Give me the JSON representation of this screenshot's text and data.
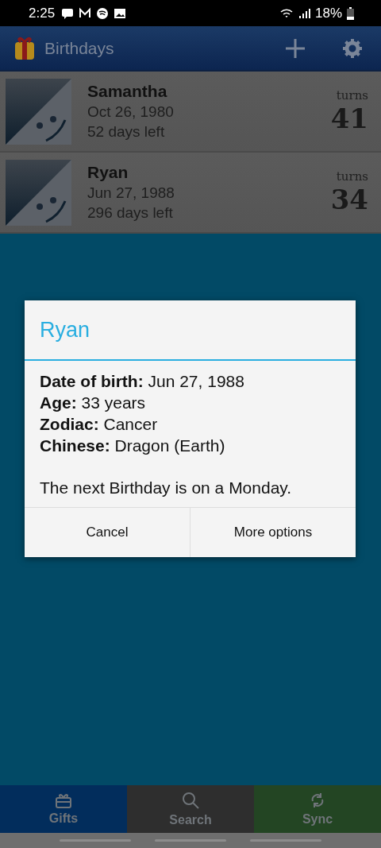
{
  "status_bar": {
    "time": "2:25",
    "battery": "18%"
  },
  "app_bar": {
    "title": "Birthdays"
  },
  "people": [
    {
      "name": "Samantha",
      "date": "Oct 26, 1980",
      "days_left": "52 days left",
      "turns_label": "turns",
      "turns": "41"
    },
    {
      "name": "Ryan",
      "date": "Jun 27, 1988",
      "days_left": "296 days left",
      "turns_label": "turns",
      "turns": "34"
    }
  ],
  "dialog": {
    "title": "Ryan",
    "lines": [
      "**Date of birth:** Jun 27, 1988",
      "**Age:** 33 years",
      "**Zodiac:** Cancer",
      "**Chinese:** Dragon (Earth)"
    ],
    "note": "The next Birthday is on a Monday.",
    "buttons": [
      "Cancel",
      "More options"
    ]
  },
  "bottom_nav": [
    {
      "label": "Gifts",
      "kind": "gift",
      "color": "#022d5c"
    },
    {
      "label": "Search",
      "kind": "search",
      "color": "#2e2e2e"
    },
    {
      "label": "Sync",
      "kind": "sync",
      "color": "#234523"
    }
  ]
}
